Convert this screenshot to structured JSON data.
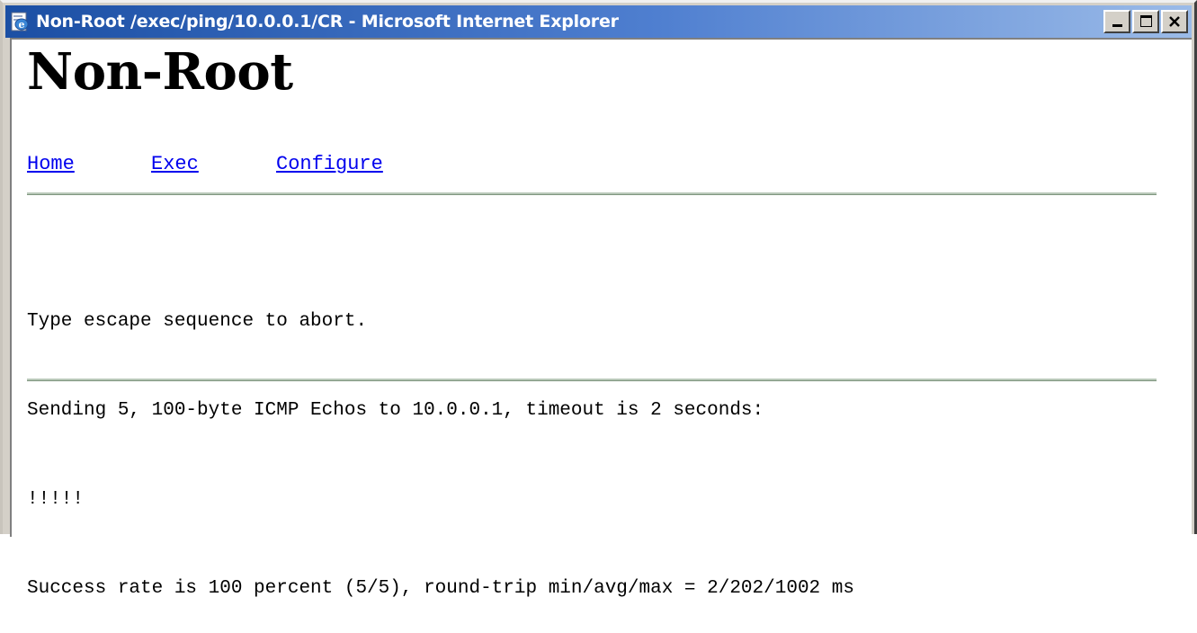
{
  "window": {
    "title": "Non-Root /exec/ping/10.0.0.1/CR - Microsoft Internet Explorer"
  },
  "page": {
    "heading": "Non-Root",
    "nav": [
      {
        "label": "Home"
      },
      {
        "label": "Exec"
      },
      {
        "label": "Configure"
      }
    ],
    "output_lines": [
      "Type escape sequence to abort.",
      "Sending 5, 100-byte ICMP Echos to 10.0.0.1, timeout is 2 seconds:",
      "!!!!!",
      "Success rate is 100 percent (5/5), round-trip min/avg/max = 2/202/1002 ms"
    ]
  },
  "icons": {
    "app": "ie-page-icon",
    "minimize": "minimize-icon",
    "maximize": "maximize-icon",
    "close": "close-icon"
  },
  "colors": {
    "titlebar_start": "#1b4fa4",
    "titlebar_end": "#9bbbe8",
    "link": "#0000ee",
    "rule": "#b9c8b9"
  }
}
